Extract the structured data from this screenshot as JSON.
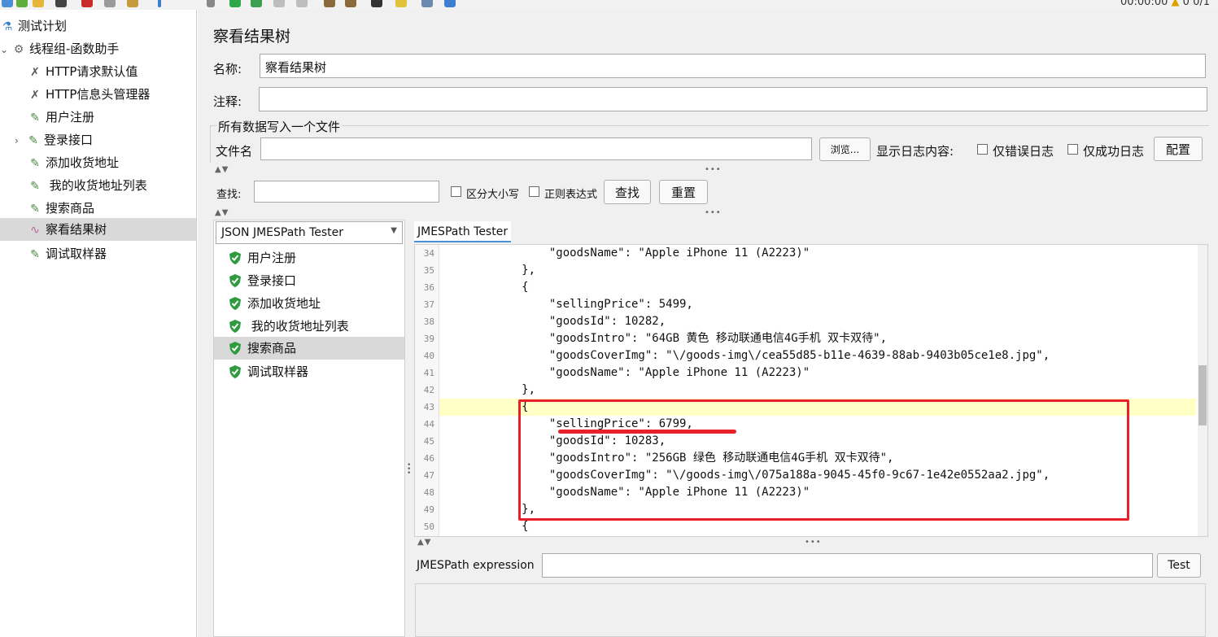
{
  "toolbar": {
    "timer": "00:00:00",
    "warning_count": "0",
    "thread_ratio": "0/1"
  },
  "tree": {
    "items": [
      {
        "label": "测试计划",
        "icon": "flask-icon"
      },
      {
        "label": "线程组-函数助手",
        "icon": "gear-icon"
      },
      {
        "label": "HTTP请求默认值",
        "icon": "wrench-icon"
      },
      {
        "label": "HTTP信息头管理器",
        "icon": "wrench-icon"
      },
      {
        "label": "用户注册",
        "icon": "pipette-icon"
      },
      {
        "label": "登录接口",
        "icon": "pipette-icon"
      },
      {
        "label": "添加收货地址",
        "icon": "pipette-icon"
      },
      {
        "label": " 我的收货地址列表",
        "icon": "pipette-icon"
      },
      {
        "label": "搜索商品",
        "icon": "pipette-icon"
      },
      {
        "label": "察看结果树",
        "icon": "graph-icon",
        "selected": true
      },
      {
        "label": "调试取样器",
        "icon": "pipette-icon"
      }
    ]
  },
  "panel": {
    "title": "察看结果树",
    "name_label": "名称:",
    "name_value": "察看结果树",
    "comment_label": "注释:",
    "comment_value": "",
    "file_section_title": "所有数据写入一个文件",
    "filename_label": "文件名",
    "filename_value": "",
    "browse_label": "浏览...",
    "log_label": "显示日志内容:",
    "errors_only_label": "仅错误日志",
    "success_only_label": "仅成功日志",
    "config_label": "配置"
  },
  "search": {
    "label": "查找:",
    "value": "",
    "case_label": "区分大小写",
    "regex_label": "正则表达式",
    "find_label": "查找",
    "reset_label": "重置"
  },
  "renderer": {
    "selected": "JSON JMESPath Tester"
  },
  "results": [
    {
      "label": "用户注册"
    },
    {
      "label": "登录接口"
    },
    {
      "label": "添加收货地址"
    },
    {
      "label": " 我的收货地址列表"
    },
    {
      "label": "搜索商品",
      "selected": true
    },
    {
      "label": "调试取样器"
    }
  ],
  "tester": {
    "tab_label": "JMESPath Tester",
    "expression_label": "JMESPath expression",
    "expression_value": "",
    "test_label": "Test"
  },
  "code": {
    "lines": [
      {
        "n": "34",
        "text": "                \"goodsName\": \"Apple iPhone 11 (A2223)\""
      },
      {
        "n": "35",
        "text": "            },"
      },
      {
        "n": "36",
        "text": "            {"
      },
      {
        "n": "37",
        "text": "                \"sellingPrice\": 5499,"
      },
      {
        "n": "38",
        "text": "                \"goodsId\": 10282,"
      },
      {
        "n": "39",
        "text": "                \"goodsIntro\": \"64GB 黄色 移动联通电信4G手机 双卡双待\","
      },
      {
        "n": "40",
        "text": "                \"goodsCoverImg\": \"\\/goods-img\\/cea55d85-b11e-4639-88ab-9403b05ce1e8.jpg\","
      },
      {
        "n": "41",
        "text": "                \"goodsName\": \"Apple iPhone 11 (A2223)\""
      },
      {
        "n": "42",
        "text": "            },"
      },
      {
        "n": "43",
        "text": "            {",
        "highlight": true
      },
      {
        "n": "44",
        "text": "                \"sellingPrice\": 6799,"
      },
      {
        "n": "45",
        "text": "                \"goodsId\": 10283,"
      },
      {
        "n": "46",
        "text": "                \"goodsIntro\": \"256GB 绿色 移动联通电信4G手机 双卡双待\","
      },
      {
        "n": "47",
        "text": "                \"goodsCoverImg\": \"\\/goods-img\\/075a188a-9045-45f0-9c67-1e42e0552aa2.jpg\","
      },
      {
        "n": "48",
        "text": "                \"goodsName\": \"Apple iPhone 11 (A2223)\""
      },
      {
        "n": "49",
        "text": "            },"
      },
      {
        "n": "50",
        "text": "            {"
      }
    ]
  },
  "colors": {
    "annotation": "#e8202a",
    "success_green": "#2e9b3e",
    "selection": "#d9d9d9",
    "line_highlight": "#ffffc6"
  }
}
